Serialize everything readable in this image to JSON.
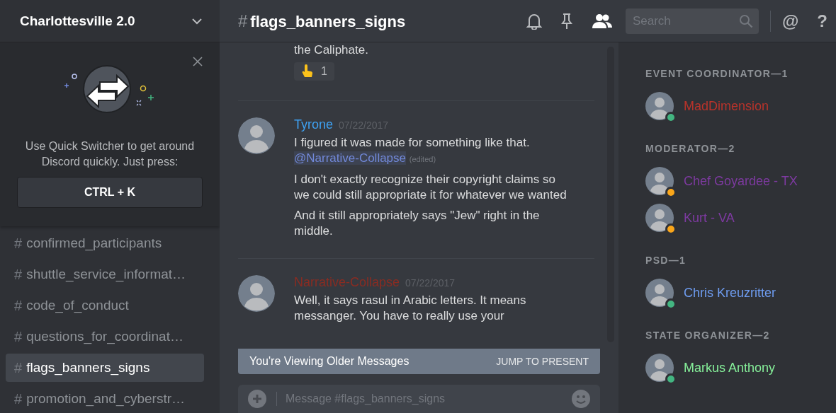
{
  "server": {
    "name": "Charlottesville 2.0"
  },
  "quick_switcher": {
    "text": "Use Quick Switcher to get around Discord quickly. Just press:",
    "shortcut": "CTRL + K"
  },
  "channels": [
    {
      "icon": "#",
      "name": "confirmed_participants",
      "selected": false
    },
    {
      "icon": "#",
      "name": "shuttle_service_informat…",
      "selected": false
    },
    {
      "icon": "#",
      "name": "code_of_conduct",
      "selected": false
    },
    {
      "icon": "#",
      "name": "questions_for_coordinat…",
      "selected": false
    },
    {
      "icon": "#",
      "name": "flags_banners_signs",
      "selected": true
    },
    {
      "icon": "#",
      "name": "promotion_and_cyberstr…",
      "selected": false
    }
  ],
  "channel_header": {
    "hash": "#",
    "name": "flags_banners_signs",
    "search_placeholder": "Search",
    "mention_icon": "@",
    "help_icon": "?"
  },
  "messages": [
    {
      "kind": "continuation",
      "lines": [
        "the Caliphate."
      ],
      "reaction_count": "1"
    },
    {
      "kind": "full",
      "author": "Tyrone",
      "color": "#3ea1f2",
      "timestamp": "07/22/2017",
      "lines": [
        "I figured it was made for something like that."
      ],
      "mention": "@Narrative-Collapse",
      "edited": "(edited)",
      "more": [
        "I don't exactly recognize their copyright claims so we could still appropriate it for whatever we wanted",
        "And it still appropriately says \"Jew\" right in the middle."
      ]
    },
    {
      "kind": "full",
      "author": "Narrative-Collapse",
      "color": "#8a2c22",
      "timestamp": "07/22/2017",
      "lines": [
        "Well, it says rasul in Arabic letters. It means messanger. You have to really use your"
      ]
    }
  ],
  "older_banner": {
    "text": "You're Viewing Older Messages",
    "action": "JUMP TO PRESENT"
  },
  "composer": {
    "placeholder": "Message #flags_banners_signs"
  },
  "member_groups": [
    {
      "title": "EVENT COORDINATOR—1",
      "members": [
        {
          "name": "MadDimension",
          "color": "#b8332b",
          "idle": false
        }
      ]
    },
    {
      "title": "MODERATOR—2",
      "members": [
        {
          "name": "Chef Goyardee - TX",
          "color": "#7d3aa0",
          "idle": true
        },
        {
          "name": "Kurt - VA",
          "color": "#7d3aa0",
          "idle": true
        }
      ]
    },
    {
      "title": "PSD—1",
      "members": [
        {
          "name": "Chris Kreuzritter",
          "color": "#6e9cf0",
          "idle": false
        }
      ]
    },
    {
      "title": "STATE ORGANIZER—2",
      "members": [
        {
          "name": "Markus Anthony",
          "color": "#86f09a",
          "idle": false
        }
      ]
    }
  ]
}
